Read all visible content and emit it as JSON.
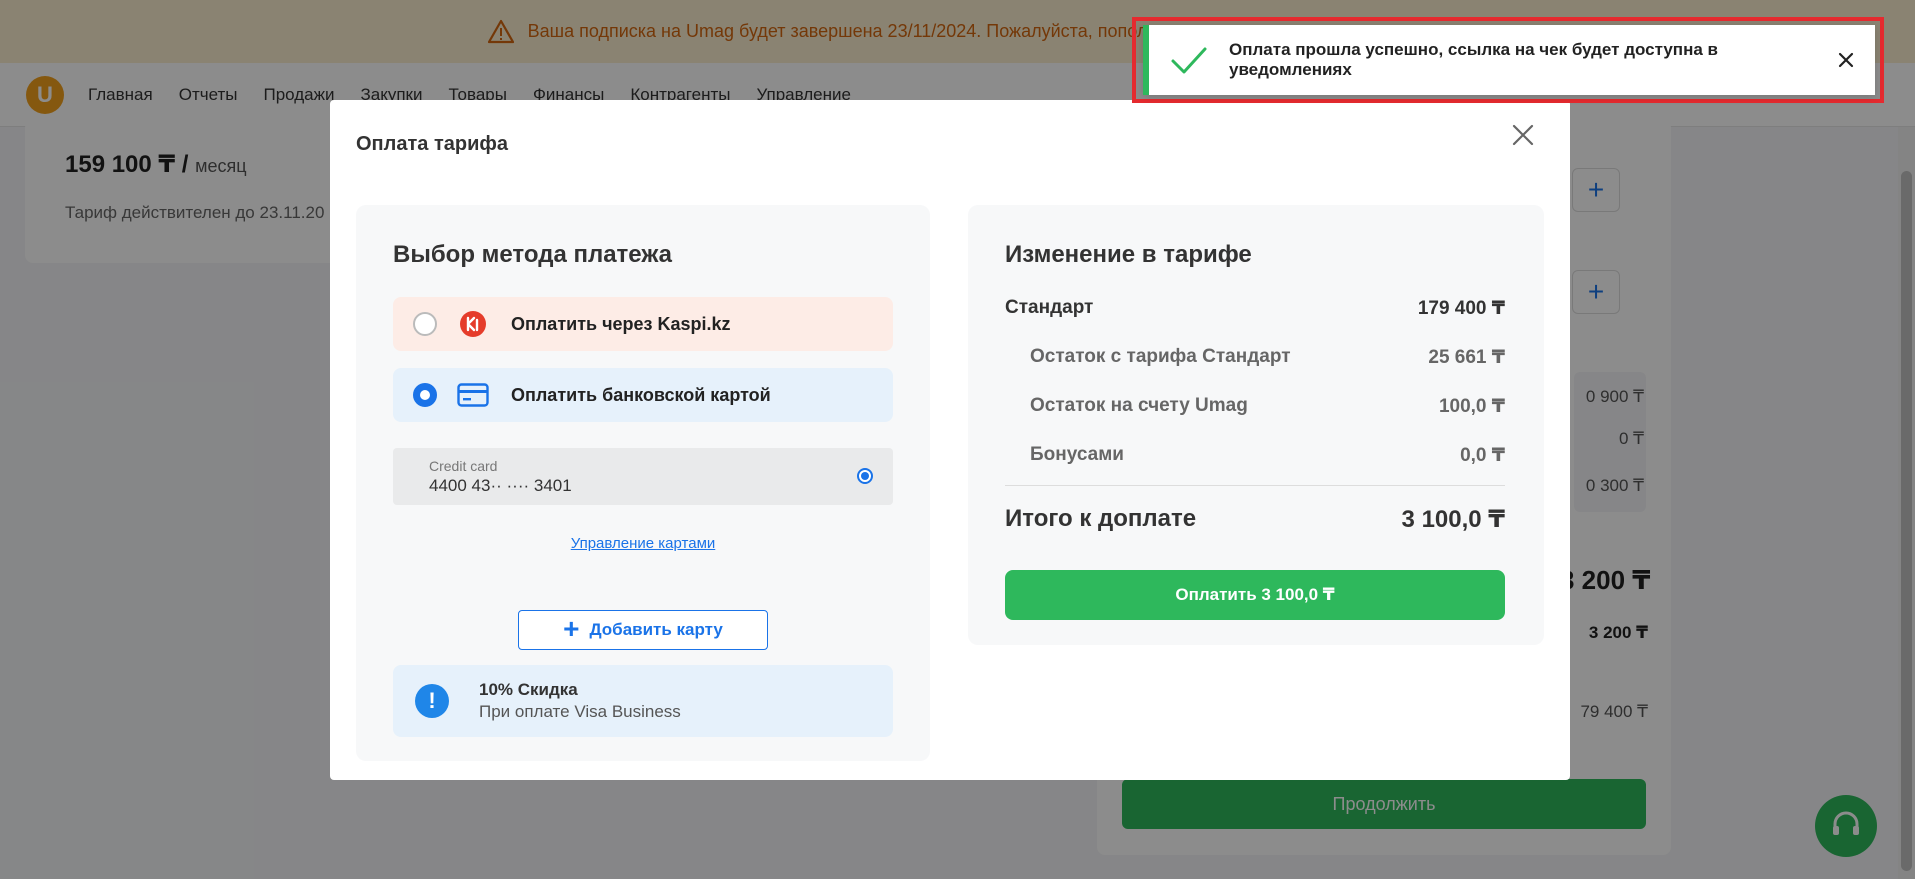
{
  "banner": {
    "text": "Ваша подписка на Umag будет завершена 23/11/2024. Пожалуйста, пополни"
  },
  "nav": {
    "logo": "U",
    "items": [
      "Главная",
      "Отчеты",
      "Продажи",
      "Закупки",
      "Товары",
      "Финансы",
      "Контрагенты",
      "Управление"
    ]
  },
  "background": {
    "price": "159 100 ₸ /",
    "price_unit": "месяц",
    "valid_until": "Тариф действителен до 23.11.20",
    "right_values": [
      "0 900 ₸",
      "0 ₸",
      "0 300 ₸"
    ],
    "big_total": "3 200 ₸",
    "sub_total": "3 200 ₸",
    "standard": "79 400 ₸",
    "continue_label": "Продолжить"
  },
  "modal": {
    "title": "Оплата тарифа",
    "payment": {
      "title": "Выбор метода платежа",
      "methods": [
        {
          "label": "Оплатить через Kaspi.kz",
          "selected": false
        },
        {
          "label": "Оплатить банковской картой",
          "selected": true
        }
      ],
      "saved_card": {
        "label": "Credit card",
        "number": "4400 43·· ···· 3401"
      },
      "manage_cards": "Управление картами",
      "add_card": "Добавить карту",
      "discount": {
        "title": "10% Скидка",
        "subtitle": "При оплате Visa Business"
      }
    },
    "summary": {
      "title": "Изменение в тарифе",
      "plan": {
        "label": "Стандарт",
        "value": "179 400 ₸"
      },
      "items": [
        {
          "label": "Остаток с тарифа Стандарт",
          "value": "25 661 ₸"
        },
        {
          "label": "Остаток на счету Umag",
          "value": "100,0 ₸"
        },
        {
          "label": "Бонусами",
          "value": "0,0 ₸"
        }
      ],
      "total": {
        "label": "Итого к доплате",
        "value": "3 100,0 ₸"
      },
      "pay_button": "Оплатить 3 100,0 ₸"
    }
  },
  "toast": {
    "message": "Оплата прошла успешно, ссылка на чек будет доступна в уведомлениях"
  },
  "colors": {
    "accent": "#1a73e8",
    "success": "#2eb85c",
    "warning": "#d3660f",
    "highlight": "#e52a2f"
  }
}
